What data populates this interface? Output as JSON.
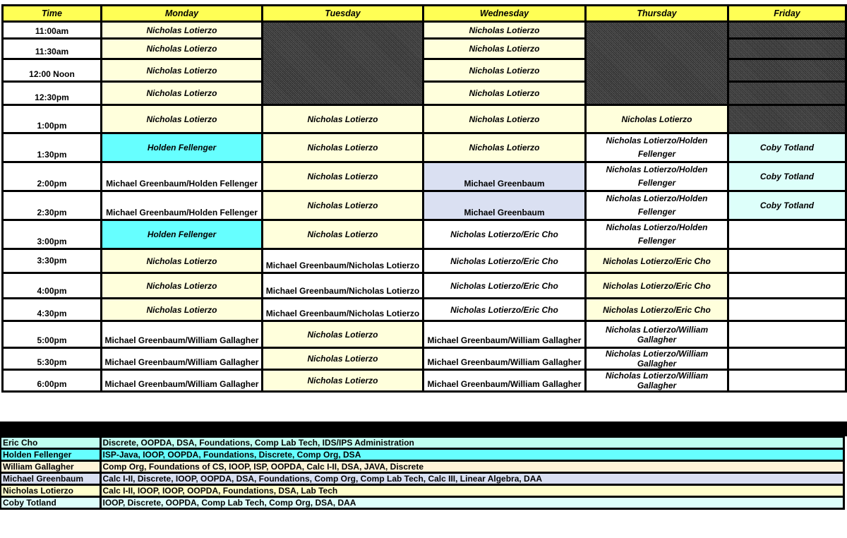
{
  "header": {
    "time": "Time",
    "days": [
      "Monday",
      "Tuesday",
      "Wednesday",
      "Thursday",
      "Friday"
    ]
  },
  "rows": [
    {
      "time": "11:00am",
      "mon": "Nicholas Lotierzo",
      "tue": "",
      "wed": "Nicholas Lotierzo",
      "thu": "",
      "fri": ""
    },
    {
      "time": "11:30am",
      "mon": "Nicholas Lotierzo",
      "tue": "",
      "wed": "Nicholas Lotierzo",
      "thu": "",
      "fri": ""
    },
    {
      "time": "12:00 Noon",
      "mon": "Nicholas Lotierzo",
      "tue": "",
      "wed": "Nicholas Lotierzo",
      "thu": "",
      "fri": ""
    },
    {
      "time": "12:30pm",
      "mon": "Nicholas Lotierzo",
      "tue": "",
      "wed": "Nicholas Lotierzo",
      "thu": "",
      "fri": ""
    },
    {
      "time": "1:00pm",
      "mon": "Nicholas Lotierzo",
      "tue": "Nicholas Lotierzo",
      "wed": "Nicholas Lotierzo",
      "thu": "Nicholas Lotierzo",
      "fri": ""
    },
    {
      "time": "1:30pm",
      "mon": "Holden Fellenger",
      "tue": "Nicholas Lotierzo",
      "wed": "Nicholas Lotierzo",
      "thu": "Nicholas Lotierzo/Holden Fellenger",
      "fri": "Coby Totland"
    },
    {
      "time": "2:00pm",
      "mon": "Michael Greenbaum/Holden Fellenger",
      "tue": "Nicholas Lotierzo",
      "wed": "Michael Greenbaum",
      "thu": "Nicholas Lotierzo/Holden Fellenger",
      "fri": "Coby Totland"
    },
    {
      "time": "2:30pm",
      "mon": "Michael Greenbaum/Holden Fellenger",
      "tue": "Nicholas Lotierzo",
      "wed": "Michael Greenbaum",
      "thu": "Nicholas Lotierzo/Holden Fellenger",
      "fri": "Coby Totland"
    },
    {
      "time": "3:00pm",
      "mon": "Holden Fellenger",
      "tue": "Nicholas Lotierzo",
      "wed": "Nicholas Lotierzo/Eric Cho",
      "thu": "Nicholas Lotierzo/Holden Fellenger",
      "fri": ""
    },
    {
      "time": "3:30pm",
      "mon": "Nicholas Lotierzo",
      "tue": "Michael Greenbaum/Nicholas Lotierzo",
      "wed": "Nicholas Lotierzo/Eric Cho",
      "thu": "Nicholas Lotierzo/Eric Cho",
      "fri": ""
    },
    {
      "time": "4:00pm",
      "mon": "Nicholas Lotierzo",
      "tue": "Michael Greenbaum/Nicholas Lotierzo",
      "wed": "Nicholas Lotierzo/Eric Cho",
      "thu": "Nicholas Lotierzo/Eric Cho",
      "fri": ""
    },
    {
      "time": "4:30pm",
      "mon": "Nicholas Lotierzo",
      "tue": "Michael Greenbaum/Nicholas Lotierzo",
      "wed": "Nicholas Lotierzo/Eric Cho",
      "thu": "Nicholas Lotierzo/Eric Cho",
      "fri": ""
    },
    {
      "time": "5:00pm",
      "mon": "Michael Greenbaum/William Gallagher",
      "tue": "Nicholas Lotierzo",
      "wed": "Michael Greenbaum/William Gallagher",
      "thu": "Nicholas Lotierzo/William Gallagher",
      "fri": ""
    },
    {
      "time": "5:30pm",
      "mon": "Michael Greenbaum/William Gallagher",
      "tue": "Nicholas Lotierzo",
      "wed": "Michael Greenbaum/William Gallagher",
      "thu": "Nicholas Lotierzo/William Gallagher",
      "fri": ""
    },
    {
      "time": "6:00pm",
      "mon": "Michael Greenbaum/William Gallagher",
      "tue": "Nicholas Lotierzo",
      "wed": "Michael Greenbaum/William Gallagher",
      "thu": "Nicholas Lotierzo/William Gallagher",
      "fri": ""
    }
  ],
  "legend": [
    {
      "name": "Eric Cho",
      "courses": "Discrete,   OOPDA, DSA, Foundations, Comp Lab Tech, IDS/IPS Administration",
      "color": "#c0fff0"
    },
    {
      "name": "Holden Fellenger",
      "courses": "ISP-Java, IOOP, OOPDA, Foundations,  Discrete, Comp Org, DSA",
      "color": "#66ffff"
    },
    {
      "name": "William Gallagher",
      "courses": "Comp Org, Foundations of CS, IOOP, ISP, OOPDA, Calc I-II, DSA, JAVA, Discrete",
      "color": "#fff4d9"
    },
    {
      "name": "Michael Greenbaum",
      "courses": "Calc I-II, Discrete, IOOP, OOPDA, DSA, Foundations, Comp Org, Comp Lab Tech, Calc III, Linear Algebra, DAA",
      "color": "#dae0f2"
    },
    {
      "name": "Nicholas Lotierzo",
      "courses": "Calc I-II, IOOP,  IOOP, OOPDA,  Foundations, DSA, Lab Tech",
      "color": "#ffffcc"
    },
    {
      "name": "Coby Totland",
      "courses": "IOOP, Discrete, OOPDA, Comp Lab Tech, Comp Org, DSA, DAA",
      "color": "#ddfffa"
    }
  ],
  "colors": {
    "header": "#ffff55",
    "nicholas_cell": "#ffffdc",
    "holden_cell": "#66ffff",
    "coby_cell": "#ddfffa",
    "michael_cell": "#dae0f2",
    "unavailable": "#3a3a3a"
  }
}
